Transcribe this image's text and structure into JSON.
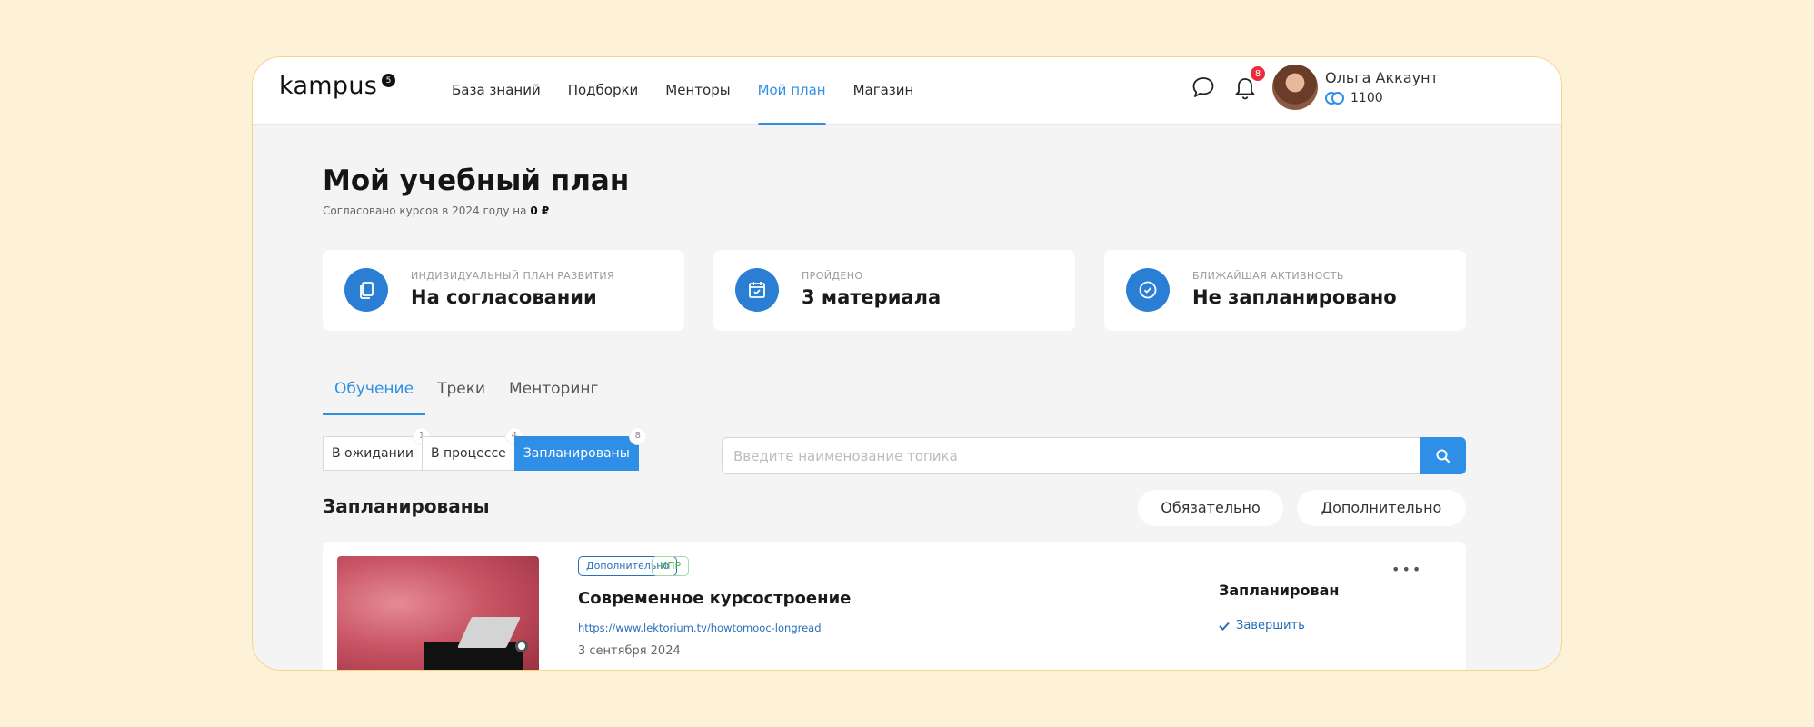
{
  "header": {
    "logo": "kampus",
    "logo_badge": "5",
    "nav": [
      "База знаний",
      "Подборки",
      "Менторы",
      "Мой план",
      "Магазин"
    ],
    "active_nav": "Мой план",
    "notifications_count": "8",
    "user_name": "Ольга Аккаунт",
    "user_coins": "1100"
  },
  "page": {
    "title": "Мой учебный план",
    "subtitle_prefix": "Согласовано курсов в 2024 году на",
    "subtitle_amount": "0 ₽"
  },
  "cards": [
    {
      "label": "ИНДИВИДУАЛЬНЫЙ ПЛАН РАЗВИТИЯ",
      "value": "На согласовании",
      "icon": "document-icon"
    },
    {
      "label": "ПРОЙДЕНО",
      "value": "3 материала",
      "icon": "calendar-check-icon"
    },
    {
      "label": "БЛИЖАЙШАЯ АКТИВНОСТЬ",
      "value": "Не запланировано",
      "icon": "check-circle-icon"
    }
  ],
  "tabs": [
    "Обучение",
    "Треки",
    "Менторинг"
  ],
  "active_tab": "Обучение",
  "filters": [
    {
      "label": "В ожидании",
      "count": "1"
    },
    {
      "label": "В процессе",
      "count": "4"
    },
    {
      "label": "Запланированы",
      "count": "8"
    }
  ],
  "active_filter": "Запланированы",
  "search": {
    "placeholder": "Введите наименование топика"
  },
  "section": {
    "title": "Запланированы",
    "pills": [
      "Обязательно",
      "Дополнительно"
    ]
  },
  "course": {
    "tags": [
      "Дополнительно",
      "ИПР"
    ],
    "title": "Современное курсостроение",
    "link": "https://www.lektorium.tv/howtomooc-longread",
    "date": "3 сентября 2024",
    "status": "Запланирован",
    "action": "Завершить",
    "more": "•••"
  },
  "colors": {
    "accent": "#2f8ee5",
    "background": "#fdf1d8",
    "badge": "#ee2b3b"
  }
}
